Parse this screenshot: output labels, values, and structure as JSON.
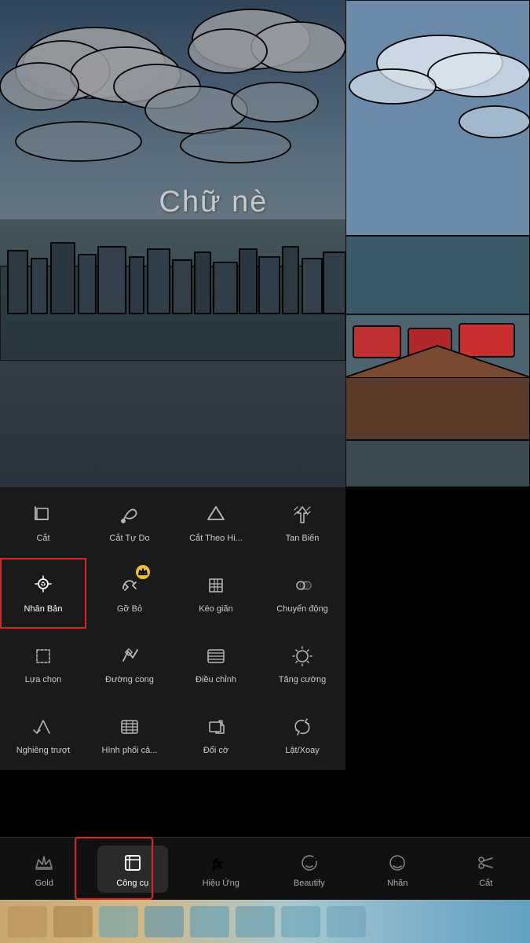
{
  "photo": {
    "text_overlay": "Chữ nè"
  },
  "tools": {
    "rows": [
      [
        {
          "id": "cat",
          "label": "Cắt",
          "icon": "crop"
        },
        {
          "id": "cat-tu-do",
          "label": "Cắt Tự Do",
          "icon": "freecut"
        },
        {
          "id": "cat-theo-hinh",
          "label": "Cắt Theo Hi...",
          "icon": "shapecut"
        },
        {
          "id": "tan-bien",
          "label": "Tan Biến",
          "icon": "dissolve"
        }
      ],
      [
        {
          "id": "nhan-ban",
          "label": "Nhân Bản",
          "icon": "clone",
          "selected": true
        },
        {
          "id": "go-bo",
          "label": "Gỡ Bỏ",
          "icon": "remove",
          "gold": true
        },
        {
          "id": "keo-gian",
          "label": "Kéo giãn",
          "icon": "stretch"
        },
        {
          "id": "chuyen-dong",
          "label": "Chuyển động",
          "icon": "motion"
        }
      ],
      [
        {
          "id": "lua-chon",
          "label": "Lựa chọn",
          "icon": "select"
        },
        {
          "id": "duong-cong",
          "label": "Đường cong",
          "icon": "curve"
        },
        {
          "id": "dieu-chinh",
          "label": "Điều chỉnh",
          "icon": "adjust"
        },
        {
          "id": "tang-cuong",
          "label": "Tăng cường",
          "icon": "enhance"
        }
      ],
      [
        {
          "id": "nghieng-truot",
          "label": "Nghiêng trượt",
          "icon": "tilt"
        },
        {
          "id": "hinh-phoi-ca",
          "label": "Hình phối cả...",
          "icon": "blend"
        },
        {
          "id": "doi-co",
          "label": "Đổi cờ",
          "icon": "resize"
        },
        {
          "id": "lat-xoay",
          "label": "Lật/Xoay",
          "icon": "fliprotate"
        }
      ]
    ]
  },
  "bottom_nav": {
    "items": [
      {
        "id": "gold",
        "label": "Gold",
        "icon": "crown"
      },
      {
        "id": "cong-cu",
        "label": "Công cụ",
        "icon": "crop-nav",
        "active": true
      },
      {
        "id": "hieu-ung",
        "label": "Hiệu Ứng",
        "icon": "fx"
      },
      {
        "id": "beautify",
        "label": "Beautify",
        "icon": "face"
      },
      {
        "id": "nhan",
        "label": "Nhãn",
        "icon": "sticker"
      },
      {
        "id": "cat-nav",
        "label": "Cắt",
        "icon": "scissors"
      }
    ]
  }
}
